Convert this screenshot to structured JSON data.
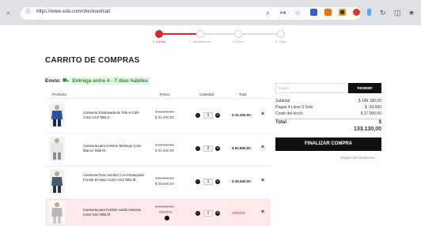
{
  "browser": {
    "url": "https://www.solo.com/checkout/cart",
    "icons": [
      "back-arrow-icon",
      "info-icon",
      "zoom-icon",
      "share-icon",
      "star-icon",
      "extension-icons",
      "reload-icon",
      "split-view-icon",
      "favorites-icon"
    ]
  },
  "steps": {
    "items": [
      {
        "label": "1. Carrito",
        "active": true
      },
      {
        "label": "2. Identificación",
        "active": false
      },
      {
        "label": "3. Envío",
        "active": false
      },
      {
        "label": "4. Pago",
        "active": false
      }
    ],
    "accent_color": "#d9272e"
  },
  "cart": {
    "title": "CARRITO DE COMPRAS",
    "shipping_label": "Envío:",
    "shipping_value": "Entrega entre 4 - 7 días hábiles",
    "headers": {
      "product": "Producto",
      "price": "Precio",
      "quantity": "Cantidad",
      "total": "Total"
    },
    "items": [
      {
        "name": "Camiseta Estampada de Tela el Café Color Azul Talla S",
        "price_old": "$ 44.000,00",
        "price_new": "$ 31.400,00",
        "quantity": "1",
        "total": "$ 31.400,00",
        "gift": false
      },
      {
        "name": "Camiseta para Hombre Melange Color Blanco Talla M",
        "price_old": "$ 44.000,00",
        "price_new": "$ 31.400,00",
        "quantity": "2",
        "total": "$ 62.800,00",
        "gift": false
      },
      {
        "name": "Camiseta Para Hombre Con Estampado Frontal En Bayo Color Azul Talla M",
        "price_old": "$ 50.000,00",
        "price_new": "$ 39.940,00",
        "quantity": "1",
        "total": "$ 39.940,00",
        "gift": false
      },
      {
        "name": "Camiseta para hombre cuello redondo Color Gris Talla M",
        "price_old": "$ 29.990,00",
        "price_new": "GRATIS",
        "quantity": "1",
        "total": "GRATIS",
        "gift": true
      }
    ]
  },
  "summary": {
    "promo_placeholder": "Cupón",
    "promo_button": "REDIMIR",
    "subtotal_label": "Subtotal",
    "subtotal_value": "$ 149.180,00",
    "discount_label": "Pague 4 Lleve 5 Solo",
    "discount_value": "$ -29.990",
    "shipping_label": "Costo del envío",
    "shipping_value": "$ 17.000,00",
    "total_label": "Total",
    "total_currency": "$",
    "total_value": "133.130,00",
    "checkout_button": "FINALIZAR COMPRA",
    "keep_shopping": "Seguir más productos"
  }
}
